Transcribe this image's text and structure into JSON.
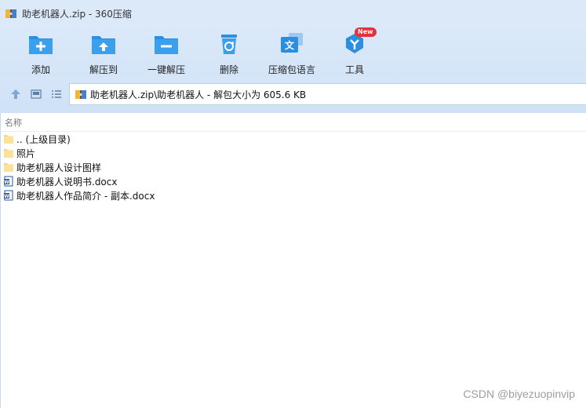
{
  "window": {
    "title": "助老机器人.zip - 360压缩"
  },
  "toolbar": {
    "items": [
      {
        "label": "添加",
        "icon": "add-folder-icon"
      },
      {
        "label": "解压到",
        "icon": "extract-to-icon"
      },
      {
        "label": "一键解压",
        "icon": "one-click-extract-icon"
      },
      {
        "label": "删除",
        "icon": "delete-icon"
      },
      {
        "label": "压缩包语言",
        "icon": "language-icon"
      },
      {
        "label": "工具",
        "icon": "tools-icon",
        "badge": "New"
      }
    ]
  },
  "address": {
    "path": "助老机器人.zip\\助老机器人 - 解包大小为 605.6 KB"
  },
  "list": {
    "column_name": "名称",
    "rows": [
      {
        "name": ".. (上级目录)",
        "type": "folder"
      },
      {
        "name": "照片",
        "type": "folder"
      },
      {
        "name": "助老机器人设计图样",
        "type": "folder"
      },
      {
        "name": "助老机器人说明书.docx",
        "type": "docx"
      },
      {
        "name": "助老机器人作品简介 - 副本.docx",
        "type": "docx"
      }
    ]
  },
  "watermark": "CSDN @biyezuopinvip",
  "colors": {
    "accent": "#2a8fe0",
    "folder": "#f7d57a",
    "title_bg": "#dbe9f9"
  }
}
